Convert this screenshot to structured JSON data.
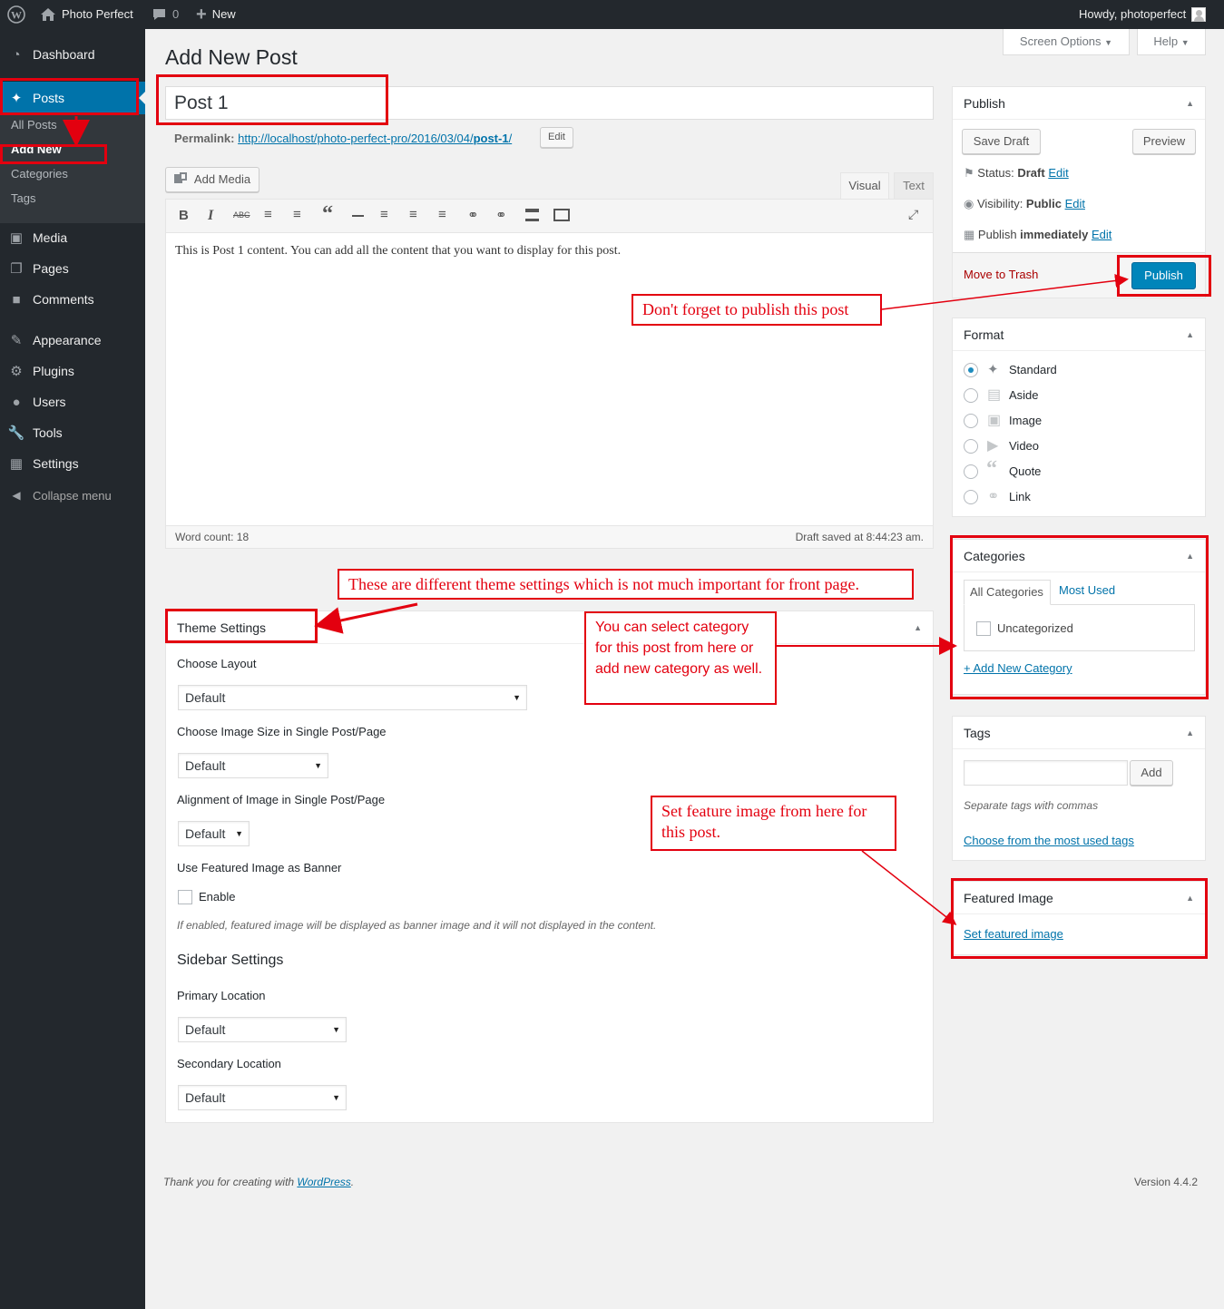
{
  "adminbar": {
    "site_name": "Photo Perfect",
    "comments_count": "0",
    "new_label": "New",
    "howdy": "Howdy, photoperfect"
  },
  "sidebar": {
    "dashboard": "Dashboard",
    "posts": "Posts",
    "sub": [
      "All Posts",
      "Add New",
      "Categories",
      "Tags"
    ],
    "media": "Media",
    "pages": "Pages",
    "comments": "Comments",
    "appearance": "Appearance",
    "plugins": "Plugins",
    "users": "Users",
    "tools": "Tools",
    "settings": "Settings",
    "collapse": "Collapse menu"
  },
  "screen_options": "Screen Options",
  "help": "Help",
  "page_title": "Add New Post",
  "post": {
    "title": "Post 1",
    "permalink_label": "Permalink:",
    "permalink_base": "http://localhost/photo-perfect-pro/2016/03/04/",
    "permalink_slug": "post-1",
    "permalink_tail": "/",
    "edit_label": "Edit",
    "add_media": "Add Media",
    "tab_visual": "Visual",
    "tab_text": "Text",
    "content": "This is Post 1 content. You can add all the content that you want  to display for this post.",
    "word_count": "Word count: 18",
    "draft_saved": "Draft saved at 8:44:23 am."
  },
  "theme_settings": {
    "title": "Theme Settings",
    "choose_layout": "Choose Layout",
    "choose_image_size": "Choose Image Size in Single Post/Page",
    "alignment": "Alignment of Image in Single Post/Page",
    "use_featured": "Use Featured Image as Banner",
    "enable": "Enable",
    "enable_desc": "If enabled, featured image will be displayed as banner image and it will not displayed in the content.",
    "sidebar_settings": "Sidebar Settings",
    "primary_location": "Primary Location",
    "secondary_location": "Secondary Location",
    "default": "Default"
  },
  "publish": {
    "title": "Publish",
    "save_draft": "Save Draft",
    "preview": "Preview",
    "status_label": "Status: ",
    "status_value": "Draft",
    "visibility_label": "Visibility: ",
    "visibility_value": "Public",
    "publish_label": "Publish ",
    "publish_value": "immediately",
    "edit": "Edit",
    "trash": "Move to Trash",
    "publish_btn": "Publish"
  },
  "format": {
    "title": "Format",
    "options": [
      "Standard",
      "Aside",
      "Image",
      "Video",
      "Quote",
      "Link"
    ],
    "selected": "Standard"
  },
  "categories": {
    "title": "Categories",
    "tab_all": "All Categories",
    "tab_used": "Most Used",
    "item": "Uncategorized",
    "add_new": "+ Add New Category"
  },
  "tags": {
    "title": "Tags",
    "add": "Add",
    "hint": "Separate tags with commas",
    "choose": "Choose from the most used tags"
  },
  "featured": {
    "title": "Featured Image",
    "set": "Set featured image"
  },
  "footer": {
    "thanks_prefix": "Thank you for creating with ",
    "wordpress": "WordPress",
    "thanks_suffix": ".",
    "version": "Version 4.4.2"
  },
  "annotations": {
    "publish_note": "Don't forget to publish this post",
    "theme_note": "These are different theme settings which is not much important for front page.",
    "category_note": "You can select category for this post from here or add new category as well.",
    "featured_note": "Set feature image from here for this post."
  },
  "colors": {
    "admin_dark": "#23282d",
    "submenu": "#32373c",
    "active_blue": "#0073aa",
    "publish_blue": "#0085ba",
    "annotation_red": "#e3000f"
  }
}
